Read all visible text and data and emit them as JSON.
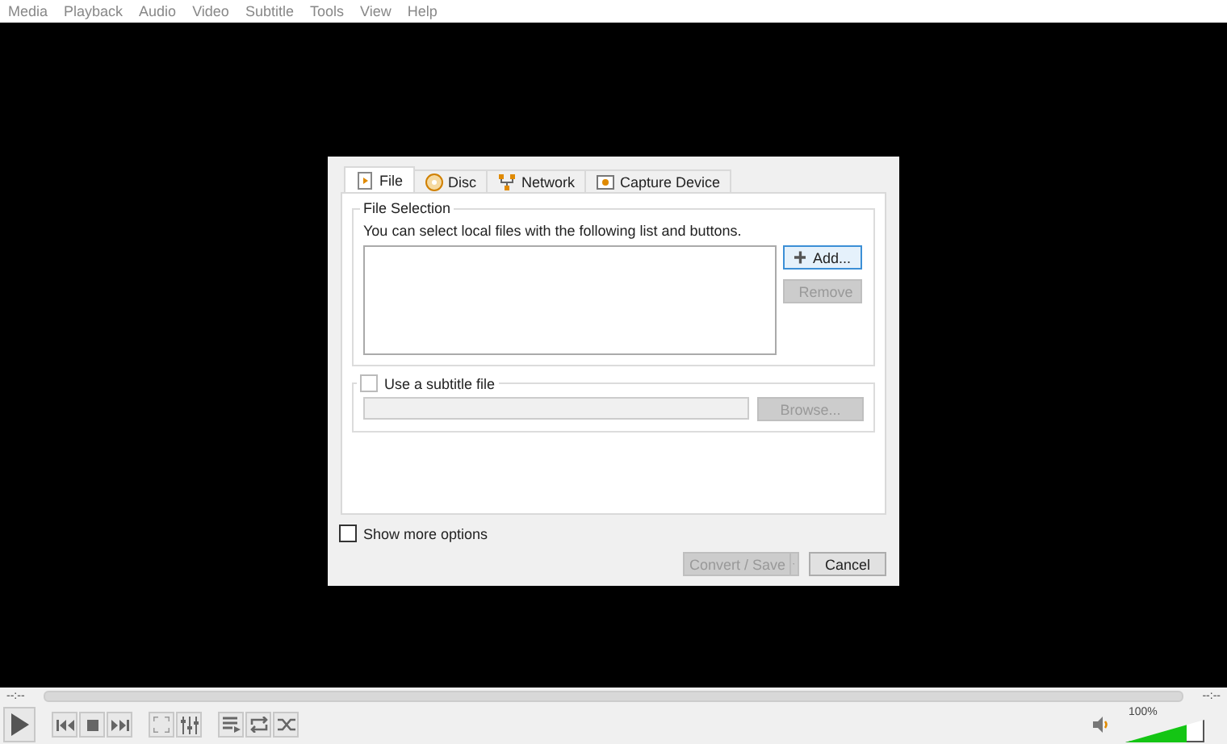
{
  "menu": [
    "Media",
    "Playback",
    "Audio",
    "Video",
    "Subtitle",
    "Tools",
    "View",
    "Help"
  ],
  "dialog": {
    "tabs": [
      {
        "label": "File",
        "selected": true
      },
      {
        "label": "Disc",
        "selected": false
      },
      {
        "label": "Network",
        "selected": false
      },
      {
        "label": "Capture Device",
        "selected": false
      }
    ],
    "file_selection": {
      "title": "File Selection",
      "hint": "You can select local files with the following list and buttons.",
      "add_button": {
        "label": "Add...",
        "disabled": false
      },
      "remove_button": {
        "label": "Remove",
        "disabled": true
      }
    },
    "subtitle": {
      "label": "Use a subtitle file",
      "checked": false,
      "browse_button": {
        "label": "Browse...",
        "disabled": true
      }
    },
    "show_more": {
      "label": "Show more options",
      "checked": false
    },
    "convert_button": {
      "label": "Convert / Save",
      "disabled": true
    },
    "cancel_button": {
      "label": "Cancel",
      "disabled": false
    }
  },
  "player": {
    "elapsed": "--:--",
    "remaining": "--:--",
    "volume": {
      "reading": "100%",
      "level": 0.8
    },
    "buttons": [
      {
        "kind": "play"
      },
      {
        "kind": "prev"
      },
      {
        "kind": "stop"
      },
      {
        "kind": "next"
      },
      {
        "kind": "fullscreen"
      },
      {
        "kind": "extended"
      },
      {
        "kind": "playlist"
      },
      {
        "kind": "loop"
      },
      {
        "kind": "random"
      }
    ]
  }
}
